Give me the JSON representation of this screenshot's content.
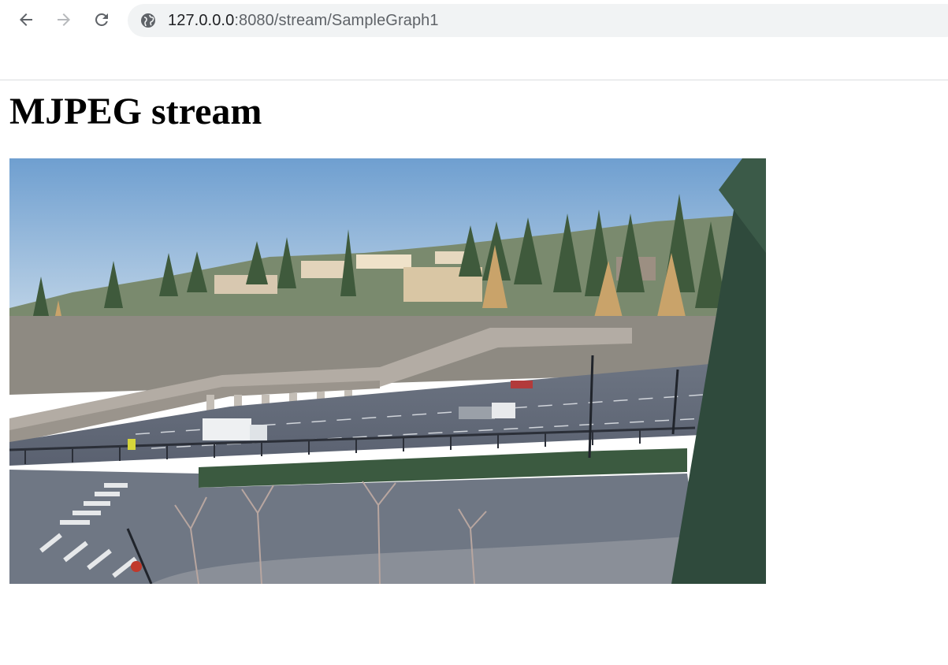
{
  "browser": {
    "url_host": "127.0.0.0",
    "url_rest": ":8080/stream/SampleGraph1",
    "icons": {
      "back": "arrow-left-icon",
      "forward": "arrow-right-icon",
      "reload": "reload-icon",
      "site": "globe-icon"
    }
  },
  "page": {
    "heading": "MJPEG stream"
  },
  "colors": {
    "heading": "#000000",
    "omnibox": "#f1f3f4",
    "sky": "#8fb6db"
  }
}
